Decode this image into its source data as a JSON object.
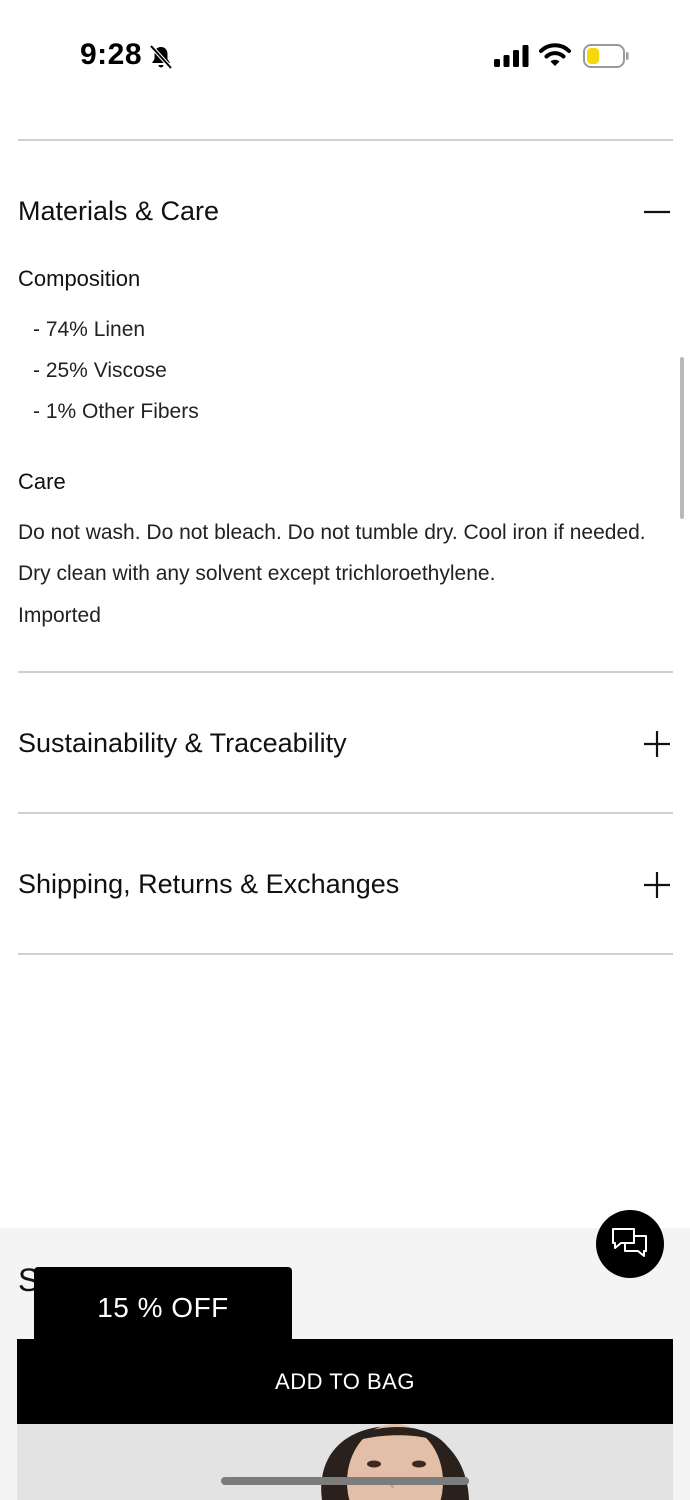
{
  "status_bar": {
    "time": "9:28",
    "icons": [
      "bell-slash-icon",
      "cellular-signal-icon",
      "wifi-icon",
      "battery-icon"
    ],
    "battery_color": "#f5d90a"
  },
  "accordions": {
    "materials": {
      "title": "Materials & Care",
      "state_icon": "minus-icon",
      "composition_heading": "Composition",
      "composition": [
        "- 74% Linen",
        "- 25% Viscose",
        "- 1% Other Fibers"
      ],
      "care_heading": "Care",
      "care_text": "Do not wash. Do not bleach. Do not tumble dry. Cool iron if needed. Dry clean with any solvent except trichloroethylene.",
      "origin": "Imported"
    },
    "sustainability": {
      "title": "Sustainability & Traceability",
      "state_icon": "plus-icon"
    },
    "shipping": {
      "title": "Shipping, Returns & Exchanges",
      "state_icon": "plus-icon"
    }
  },
  "bottom": {
    "partial_heading": "S",
    "promo": "15 % OFF",
    "add_to_bag": "ADD TO BAG",
    "chat_icon": "chat-bubbles-icon"
  }
}
